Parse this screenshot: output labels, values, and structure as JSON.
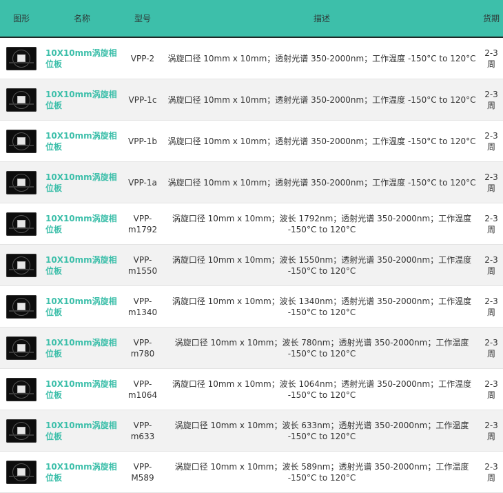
{
  "header": {
    "image": "图形",
    "name": "名称",
    "model": "型号",
    "desc": "描述",
    "lead": "货期"
  },
  "rows": [
    {
      "name": "10X10mm涡旋相位板",
      "model": "VPP-2",
      "desc": "涡旋口径 10mm x 10mm；透射光谱 350-2000nm；工作温度 -150°C to 120°C",
      "lead": "2-3周"
    },
    {
      "name": "10X10mm涡旋相位板",
      "model": "VPP-1c",
      "desc": "涡旋口径 10mm x 10mm；透射光谱 350-2000nm；工作温度 -150°C to 120°C",
      "lead": "2-3周"
    },
    {
      "name": "10X10mm涡旋相位板",
      "model": "VPP-1b",
      "desc": "涡旋口径 10mm x 10mm；透射光谱 350-2000nm；工作温度 -150°C to 120°C",
      "lead": "2-3周"
    },
    {
      "name": "10X10mm涡旋相位板",
      "model": "VPP-1a",
      "desc": "涡旋口径 10mm x 10mm；透射光谱 350-2000nm；工作温度 -150°C to 120°C",
      "lead": "2-3周"
    },
    {
      "name": "10X10mm涡旋相位板",
      "model": "VPP-m1792",
      "desc": "涡旋口径 10mm x 10mm；波长 1792nm；透射光谱 350-2000nm；工作温度 -150°C to 120°C",
      "lead": "2-3周"
    },
    {
      "name": "10X10mm涡旋相位板",
      "model": "VPP-m1550",
      "desc": "涡旋口径 10mm x 10mm；波长 1550nm；透射光谱 350-2000nm；工作温度 -150°C to 120°C",
      "lead": "2-3周"
    },
    {
      "name": "10X10mm涡旋相位板",
      "model": "VPP-m1340",
      "desc": "涡旋口径 10mm x 10mm；波长 1340nm；透射光谱 350-2000nm；工作温度 -150°C to 120°C",
      "lead": "2-3周"
    },
    {
      "name": "10X10mm涡旋相位板",
      "model": "VPP-m780",
      "desc": "涡旋口径 10mm x 10mm；波长 780nm；透射光谱 350-2000nm；工作温度 -150°C to 120°C",
      "lead": "2-3周"
    },
    {
      "name": "10X10mm涡旋相位板",
      "model": "VPP-m1064",
      "desc": "涡旋口径 10mm x 10mm；波长 1064nm；透射光谱 350-2000nm；工作温度 -150°C to 120°C",
      "lead": "2-3周"
    },
    {
      "name": "10X10mm涡旋相位板",
      "model": "VPP-m633",
      "desc": "涡旋口径 10mm x 10mm；波长 633nm；透射光谱 350-2000nm；工作温度 -150°C to 120°C",
      "lead": "2-3周"
    },
    {
      "name": "10X10mm涡旋相位板",
      "model": "VPP-M589",
      "desc": "涡旋口径 10mm x 10mm；波长 589nm；透射光谱 350-2000nm；工作温度 -150°C to 120°C",
      "lead": "2-3周"
    }
  ],
  "colors": {
    "header_bg": "#3dbfaa",
    "name_link": "#3dbfaa",
    "row_alt": "#f2f2f2"
  },
  "icons": {
    "product_thumbnail": "vortex-phase-plate-photo"
  }
}
